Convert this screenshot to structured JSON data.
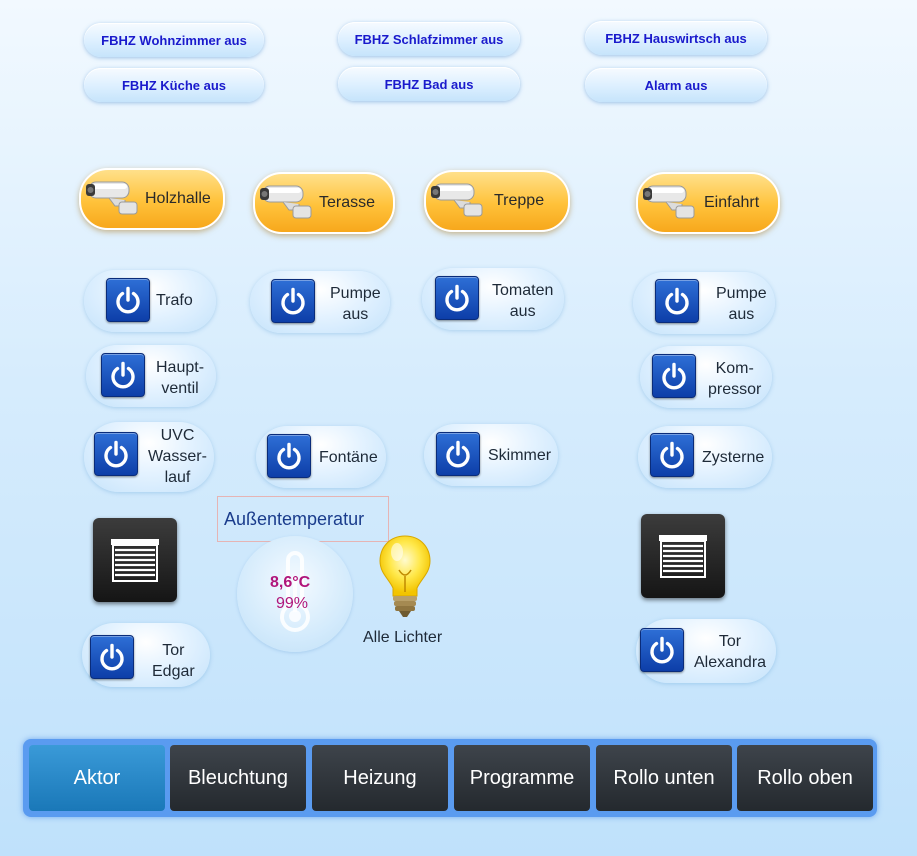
{
  "heating": {
    "wohnzimmer": "FBHZ Wohnzimmer aus",
    "schlafzimmer": "FBHZ Schlafzimmer aus",
    "hauswirtsch": "FBHZ Hauswirtsch aus",
    "kueche": "FBHZ Küche aus",
    "bad": "FBHZ Bad aus",
    "alarm": "Alarm aus"
  },
  "cameras": {
    "holzhalle": "Holzhalle",
    "terasse": "Terasse",
    "treppe": "Treppe",
    "einfahrt": "Einfahrt"
  },
  "actors": {
    "trafo": "Trafo",
    "pumpe1": "Pumpe\naus",
    "tomaten": "Tomaten\naus",
    "pumpe2": "Pumpe\naus",
    "hauptventil": "Haupt-\nventil",
    "kompressor": "Kom-\npressor",
    "uvc": "UVC\nWasser-\nlauf",
    "fontaene": "Fontäne",
    "skimmer": "Skimmer",
    "zysterne": "Zysterne",
    "tor_edgar": "Tor\nEdgar",
    "tor_alexandra": "Tor\nAlexandra"
  },
  "weather": {
    "title": "Außentemperatur",
    "temperature": "8,6°C",
    "humidity": "99%"
  },
  "lights": {
    "label": "Alle Lichter"
  },
  "tabs": [
    "Aktor",
    "Bleuchtung",
    "Heizung",
    "Programme",
    "Rollo unten",
    "Rollo oben"
  ],
  "colors": {
    "heating_text": "#1a1acc",
    "camera_button": "#ffc23a",
    "power_icon": "#0d3ea8",
    "temperature_text": "#b0157a",
    "active_tab": "#1a78b8",
    "tab": "#2c3238"
  },
  "icons": {
    "camera": "camera-icon",
    "power": "power-icon",
    "shutter": "shutter-icon",
    "thermometer": "thermometer-icon",
    "bulb": "light-bulb-icon"
  }
}
